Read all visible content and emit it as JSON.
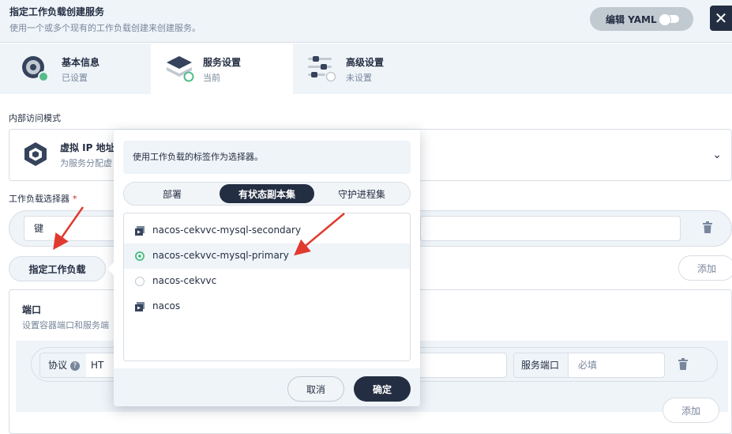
{
  "header": {
    "title": "指定工作负载创建服务",
    "subtitle": "使用一个或多个现有的工作负载创建来创建服务。",
    "edit_yaml_label": "编辑 YAML",
    "close_icon": "close-icon"
  },
  "steps": [
    {
      "title": "基本信息",
      "status": "已设置",
      "icon": "info-icon"
    },
    {
      "title": "服务设置",
      "status": "当前",
      "icon": "service-settings-icon"
    },
    {
      "title": "高级设置",
      "status": "未设置",
      "icon": "advanced-settings-icon"
    }
  ],
  "access_mode": {
    "section_label": "内部访问模式",
    "title": "虚拟 IP 地址",
    "subtitle": "为服务分配虚"
  },
  "selector": {
    "label": "工作负载选择器",
    "required_mark": "*",
    "key_placeholder": "键",
    "specify_workload_button": "指定工作负载",
    "add_button": "添加"
  },
  "ports": {
    "title": "端口",
    "subtitle": "设置容器端口和服务端",
    "protocol_label": "协议",
    "protocol_value": "HT",
    "service_port_label": "服务端口",
    "service_port_placeholder": "必填",
    "add_button": "添加"
  },
  "popover": {
    "description": "使用工作负载的标签作为选择器。",
    "tabs": [
      "部署",
      "有状态副本集",
      "守护进程集"
    ],
    "active_tab": 1,
    "items": [
      {
        "name": "nacos-cekvvc-mysql-secondary",
        "marker": "workload-icon"
      },
      {
        "name": "nacos-cekvvc-mysql-primary",
        "marker": "radio-selected"
      },
      {
        "name": "nacos-cekvvc",
        "marker": "radio-empty"
      },
      {
        "name": "nacos",
        "marker": "workload-icon"
      }
    ],
    "cancel_label": "取消",
    "ok_label": "确定"
  },
  "colors": {
    "dark": "#242e42",
    "muted": "#79879c",
    "light_bg": "#eff4f9",
    "border": "#d8dee5",
    "green": "#55bc8a",
    "annotation_red": "#e03a2f"
  }
}
